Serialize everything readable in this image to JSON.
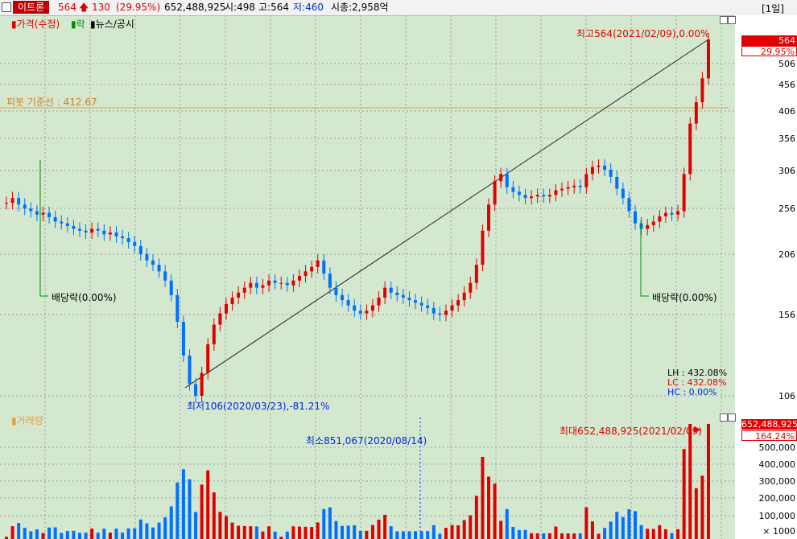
{
  "header": {
    "stock_name": "이트론",
    "price": "564",
    "change": "130",
    "change_pct": "(29.95%)",
    "volume": "652,488,925",
    "open": "시:498",
    "high": "고:564",
    "low": "저:460",
    "market_cap": "시총:2,958억",
    "period": "[1일]"
  },
  "legend": {
    "price_label": "가격(수정)",
    "ex_label": "락",
    "news_label": "뉴스/공시"
  },
  "volume_legend": "거래량",
  "annotations": {
    "max_price": "최고564(2021/02/09),0.00%",
    "min_price": "최저106(2020/03/23),-81.21%",
    "pivot": "피봇 기준선 : 412.67",
    "dividend_left": "배당락(0.00%)",
    "dividend_right": "배당락(0.00%)",
    "max_volume": "최대652,488,925(2021/02/09)",
    "min_volume": "최소851,067(2020/08/14)",
    "lh": "LH  : 432.08%",
    "lc": "LC  : 432.08%",
    "hc": "HC  :   0.00%"
  },
  "price_axis": {
    "current": "564",
    "current_pct": "29.95%",
    "ticks": [
      "506",
      "456",
      "406",
      "356",
      "306",
      "256",
      "206",
      "156",
      "106"
    ]
  },
  "volume_axis": {
    "current": "652,488,925",
    "current_pct": "164.24%",
    "ticks": [
      "500,000",
      "400,000",
      "300,000",
      "200,000",
      "100,000"
    ],
    "unit": "× 1000"
  },
  "colors": {
    "up": "#e00000",
    "down": "#0070ff",
    "bg": "#d4e8d0",
    "pivot": "#e0a040"
  },
  "chart_data": {
    "type": "candlestick",
    "series": [
      {
        "name": "가격(수정)",
        "close": [
          262,
          268,
          260,
          255,
          252,
          248,
          250,
          245,
          240,
          238,
          235,
          232,
          230,
          228,
          232,
          230,
          226,
          228,
          224,
          222,
          218,
          214,
          206,
          200,
          196,
          190,
          182,
          170,
          150,
          128,
          112,
          106,
          118,
          135,
          148,
          156,
          163,
          168,
          172,
          176,
          180,
          176,
          178,
          182,
          180,
          180,
          178,
          182,
          186,
          190,
          194,
          200,
          188,
          176,
          170,
          166,
          162,
          158,
          156,
          158,
          162,
          168,
          176,
          172,
          170,
          168,
          166,
          164,
          162,
          160,
          156,
          155,
          158,
          162,
          166,
          172,
          180,
          196,
          230,
          260,
          290,
          300,
          282,
          276,
          272,
          268,
          270,
          272,
          270,
          272,
          278,
          280,
          282,
          284,
          282,
          300,
          310,
          312,
          306,
          296,
          280,
          268,
          252,
          238,
          232,
          236,
          240,
          246,
          250,
          248,
          252,
          300,
          380,
          420,
          470,
          564
        ]
      }
    ],
    "volume": {
      "max": 652488925,
      "min": 851067
    },
    "price_range": [
      106,
      564
    ]
  }
}
